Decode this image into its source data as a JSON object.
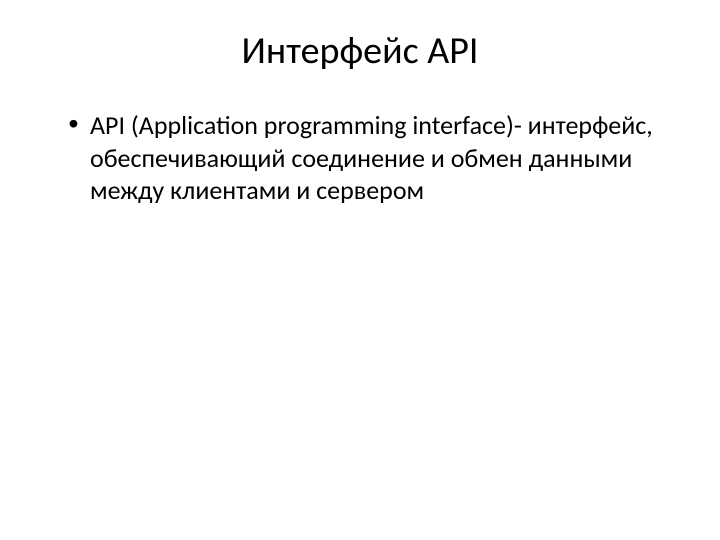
{
  "slide": {
    "title": "Интерфейс API",
    "bullets": [
      "API (Application programming interface)- интерфейс, обеспечивающий соединение и обмен данными между клиентами и сервером"
    ]
  }
}
